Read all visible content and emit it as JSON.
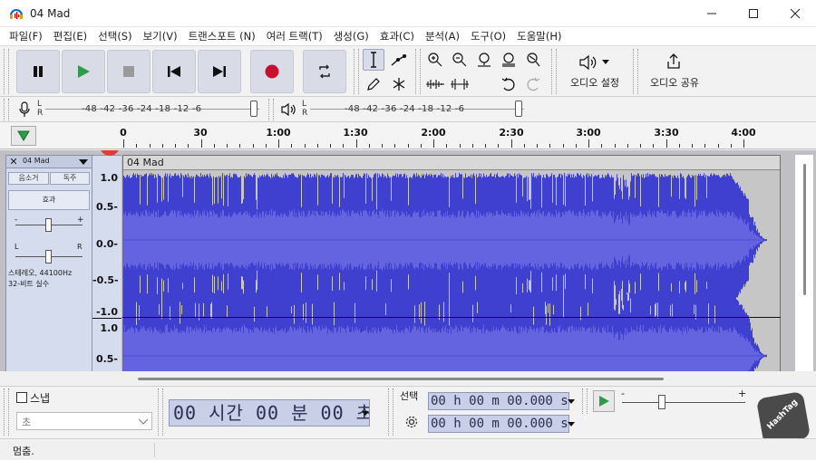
{
  "window": {
    "title": "04 Mad",
    "minimize_icon": "minimize-icon",
    "maximize_icon": "maximize-icon",
    "close_icon": "close-icon"
  },
  "menu": [
    "파일(F)",
    "편집(E)",
    "선택(S)",
    "보기(V)",
    "트랜스포트 (N)",
    "여러 트랙(T)",
    "생성(G)",
    "효과(C)",
    "분석(A)",
    "도구(O)",
    "도움말(H)"
  ],
  "toolbar": {
    "transport": [
      "pause-icon",
      "play-icon",
      "stop-icon",
      "skip-start-icon",
      "skip-end-icon",
      "record-icon",
      "loop-icon"
    ],
    "audio_setup_label": "오디오 설정",
    "audio_share_label": "오디오 공유"
  },
  "meters": {
    "record_scale": "-48 -42 -36   -24 -18 -12  -6",
    "play_scale": "-48 -42 -36   -24 -18 -12  -6",
    "left": "L",
    "right": "R"
  },
  "timeline": {
    "labels": [
      "0",
      "30",
      "1:00",
      "1:30",
      "2:00",
      "2:30",
      "3:00",
      "3:30",
      "4:00"
    ]
  },
  "track": {
    "name": "04 Mad",
    "mute_label": "음소거",
    "solo_label": "독주",
    "effects_label": "효과",
    "info_line1": "스테레오, 44100Hz",
    "info_line2": "32-비트 실수",
    "gain_minus": "-",
    "gain_plus": "+",
    "pan_left": "L",
    "pan_right": "R",
    "clip_name": "04 Mad",
    "scale_ch1": [
      "1.0",
      "0.5-",
      "0.0-",
      "-0.5-",
      "-1.0"
    ],
    "scale_ch2": [
      "1.0",
      "0.5-"
    ],
    "badge": "1"
  },
  "colors": {
    "wave": "#3f3fd0",
    "wave_rms": "#6464e0",
    "wave_bg": "#c6c6c6"
  },
  "bottom": {
    "snap_label": "스냅",
    "snap_unit": "초",
    "time_display": "00 시간 00 분 00 초",
    "selection_label": "선택",
    "sel_start": "00 h 00 m 00.000 s",
    "sel_end": "00 h 00 m 00.000 s",
    "speed_minus": "-",
    "speed_plus": "+"
  },
  "status": {
    "text": "멈춤."
  },
  "watermark": "HashTag"
}
